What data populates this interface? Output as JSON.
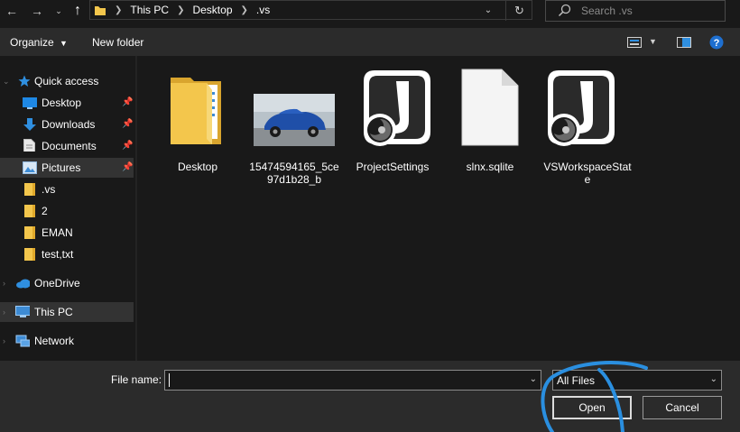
{
  "nav": {
    "back_icon": "arrow-left-icon",
    "forward_icon": "arrow-right-icon",
    "recent_icon": "chevron-down-icon",
    "up_icon": "arrow-up-icon"
  },
  "address": {
    "crumbs": [
      "This PC",
      "Desktop",
      ".vs"
    ],
    "refresh_icon": "refresh-icon"
  },
  "search": {
    "placeholder": "Search .vs"
  },
  "toolbar": {
    "organize_label": "Organize",
    "new_folder_label": "New folder"
  },
  "sidebar": {
    "quick_access": "Quick access",
    "items": [
      {
        "label": "Desktop",
        "icon": "desktop-icon",
        "pinned": true
      },
      {
        "label": "Downloads",
        "icon": "download-icon",
        "pinned": true
      },
      {
        "label": "Documents",
        "icon": "document-icon",
        "pinned": true
      },
      {
        "label": "Pictures",
        "icon": "pictures-icon",
        "pinned": true,
        "selected": true
      },
      {
        "label": ".vs",
        "icon": "folder-icon"
      },
      {
        "label": "2",
        "icon": "folder-icon"
      },
      {
        "label": "EMAN",
        "icon": "folder-icon"
      },
      {
        "label": "test,txt",
        "icon": "folder-icon"
      }
    ],
    "onedrive": "OneDrive",
    "this_pc": "This PC",
    "network": "Network"
  },
  "files": [
    {
      "name": "Desktop",
      "type": "folder"
    },
    {
      "name": "15474594165_5ce97d1b28_b",
      "type": "image"
    },
    {
      "name": "ProjectSettings",
      "type": "json"
    },
    {
      "name": "slnx.sqlite",
      "type": "file"
    },
    {
      "name": "VSWorkspaceState",
      "type": "json"
    }
  ],
  "bottom": {
    "file_name_label": "File name:",
    "file_name_value": "",
    "filter_value": "All Files",
    "open_label": "Open",
    "cancel_label": "Cancel"
  },
  "colors": {
    "annotation": "#2a8fe0",
    "folder": "#f3c64c",
    "accent": "#1e88e5"
  }
}
